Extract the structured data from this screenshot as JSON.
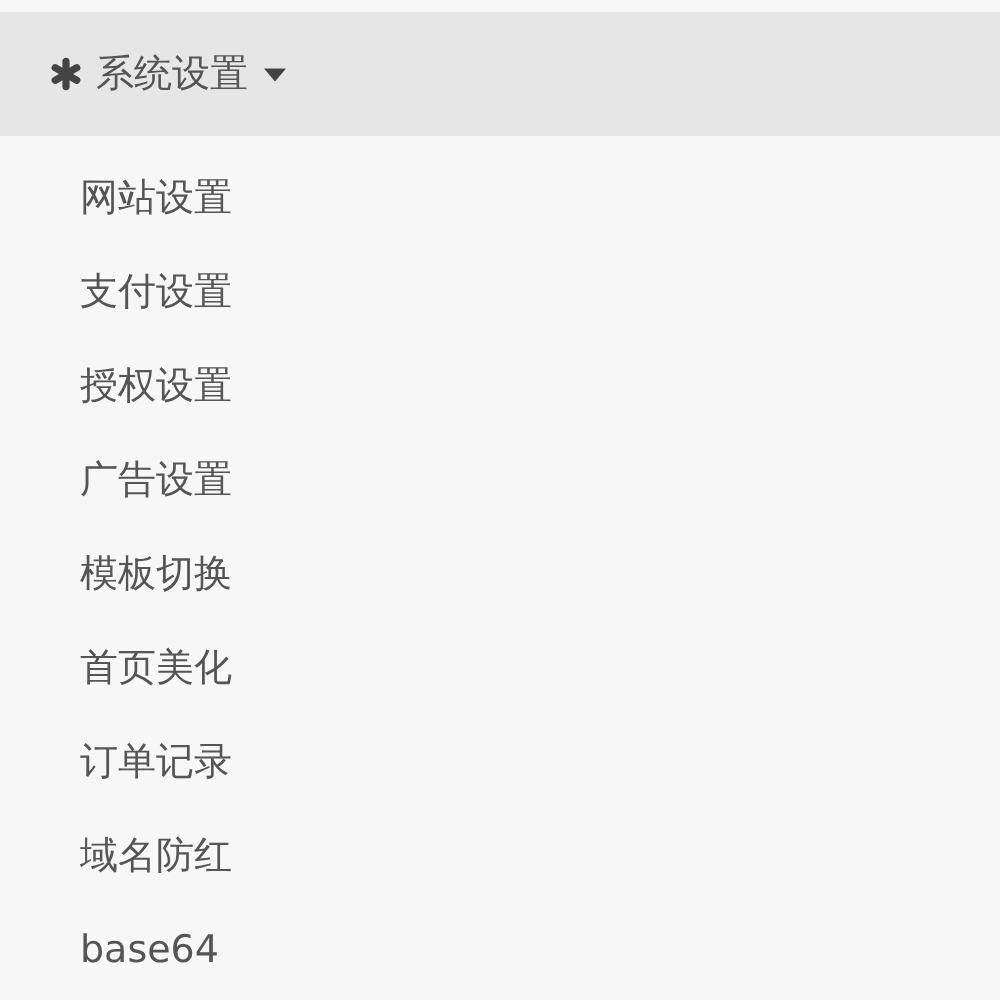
{
  "menu": {
    "title": "系统设置",
    "expanded": true,
    "items": [
      {
        "label": "网站设置"
      },
      {
        "label": "支付设置"
      },
      {
        "label": "授权设置"
      },
      {
        "label": "广告设置"
      },
      {
        "label": "模板切换"
      },
      {
        "label": "首页美化"
      },
      {
        "label": "订单记录"
      },
      {
        "label": "域名防红"
      },
      {
        "label": "base64"
      }
    ]
  }
}
